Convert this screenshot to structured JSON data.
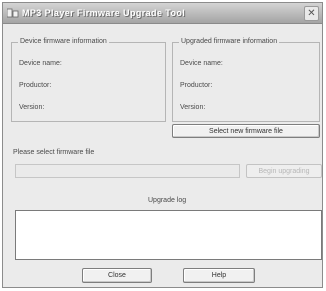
{
  "window": {
    "title": "MP3 Player Firmware Upgrade Tool",
    "close_glyph": "✕"
  },
  "device_group": {
    "legend": "Device firmware information",
    "device_name_label": "Device name:",
    "productor_label": "Productor:",
    "version_label": "Version:"
  },
  "upgrade_group": {
    "legend": "Upgraded firmware information",
    "device_name_label": "Device name:",
    "productor_label": "Productor:",
    "version_label": "Version:"
  },
  "select_file_button": "Select new firmware file",
  "file_prompt": "Please select firmware file",
  "file_path_value": "",
  "begin_button": "Begin upgrading",
  "log": {
    "label": "Upgrade log",
    "content": ""
  },
  "footer": {
    "close_button": "Close",
    "help_button": "Help"
  }
}
